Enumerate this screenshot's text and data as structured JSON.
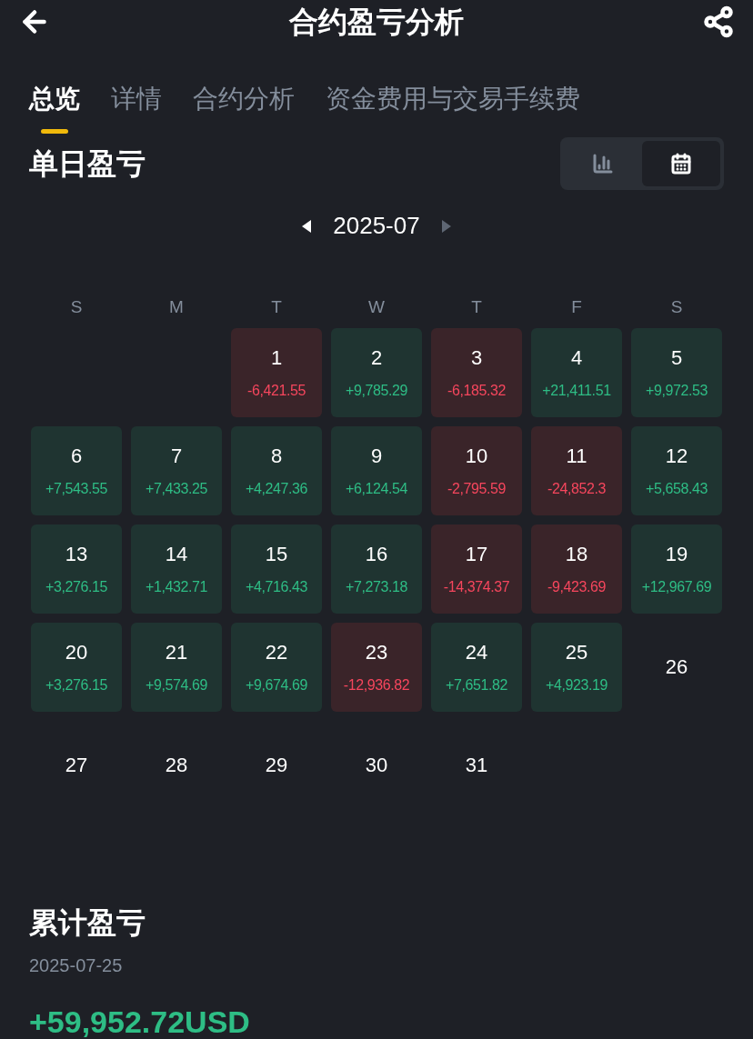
{
  "header": {
    "title": "合约盈亏分析"
  },
  "tabs": [
    {
      "label": "总览",
      "selected": true
    },
    {
      "label": "详情",
      "selected": false
    },
    {
      "label": "合约分析",
      "selected": false
    },
    {
      "label": "资金费用与交易手续费",
      "selected": false
    }
  ],
  "daily": {
    "title": "单日盈亏",
    "view_toggle": [
      {
        "kind": "chart",
        "selected": false
      },
      {
        "kind": "calendar",
        "selected": true
      }
    ],
    "month": "2025-07"
  },
  "weekdays": [
    "S",
    "M",
    "T",
    "W",
    "T",
    "F",
    "S"
  ],
  "weeks": [
    [
      {
        "kind": "blank"
      },
      {
        "kind": "blank"
      },
      {
        "kind": "loss",
        "day": "1",
        "pnl": "-6,421.55"
      },
      {
        "kind": "profit",
        "day": "2",
        "pnl": "+9,785.29"
      },
      {
        "kind": "loss",
        "day": "3",
        "pnl": "-6,185.32"
      },
      {
        "kind": "profit",
        "day": "4",
        "pnl": "+21,411.51"
      },
      {
        "kind": "profit",
        "day": "5",
        "pnl": "+9,972.53"
      }
    ],
    [
      {
        "kind": "profit",
        "day": "6",
        "pnl": "+7,543.55"
      },
      {
        "kind": "profit",
        "day": "7",
        "pnl": "+7,433.25"
      },
      {
        "kind": "profit",
        "day": "8",
        "pnl": "+4,247.36"
      },
      {
        "kind": "profit",
        "day": "9",
        "pnl": "+6,124.54"
      },
      {
        "kind": "loss",
        "day": "10",
        "pnl": "-2,795.59"
      },
      {
        "kind": "loss",
        "day": "11",
        "pnl": "-24,852.3"
      },
      {
        "kind": "profit",
        "day": "12",
        "pnl": "+5,658.43"
      }
    ],
    [
      {
        "kind": "profit",
        "day": "13",
        "pnl": "+3,276.15"
      },
      {
        "kind": "profit",
        "day": "14",
        "pnl": "+1,432.71"
      },
      {
        "kind": "profit",
        "day": "15",
        "pnl": "+4,716.43"
      },
      {
        "kind": "profit",
        "day": "16",
        "pnl": "+7,273.18"
      },
      {
        "kind": "loss",
        "day": "17",
        "pnl": "-14,374.37"
      },
      {
        "kind": "loss",
        "day": "18",
        "pnl": "-9,423.69"
      },
      {
        "kind": "profit",
        "day": "19",
        "pnl": "+12,967.69"
      }
    ],
    [
      {
        "kind": "profit",
        "day": "20",
        "pnl": "+3,276.15"
      },
      {
        "kind": "profit",
        "day": "21",
        "pnl": "+9,574.69"
      },
      {
        "kind": "profit",
        "day": "22",
        "pnl": "+9,674.69"
      },
      {
        "kind": "loss",
        "day": "23",
        "pnl": "-12,936.82"
      },
      {
        "kind": "profit",
        "day": "24",
        "pnl": "+7,651.82"
      },
      {
        "kind": "profit",
        "day": "25",
        "pnl": "+4,923.19"
      },
      {
        "kind": "plain",
        "day": "26"
      }
    ],
    [
      {
        "kind": "plain",
        "day": "27"
      },
      {
        "kind": "plain",
        "day": "28"
      },
      {
        "kind": "plain",
        "day": "29"
      },
      {
        "kind": "plain",
        "day": "30"
      },
      {
        "kind": "plain",
        "day": "31"
      },
      {
        "kind": "blank"
      },
      {
        "kind": "blank"
      }
    ]
  ],
  "cumulative": {
    "title": "累计盈亏",
    "date": "2025-07-25",
    "value": "+59,952.72USD"
  }
}
